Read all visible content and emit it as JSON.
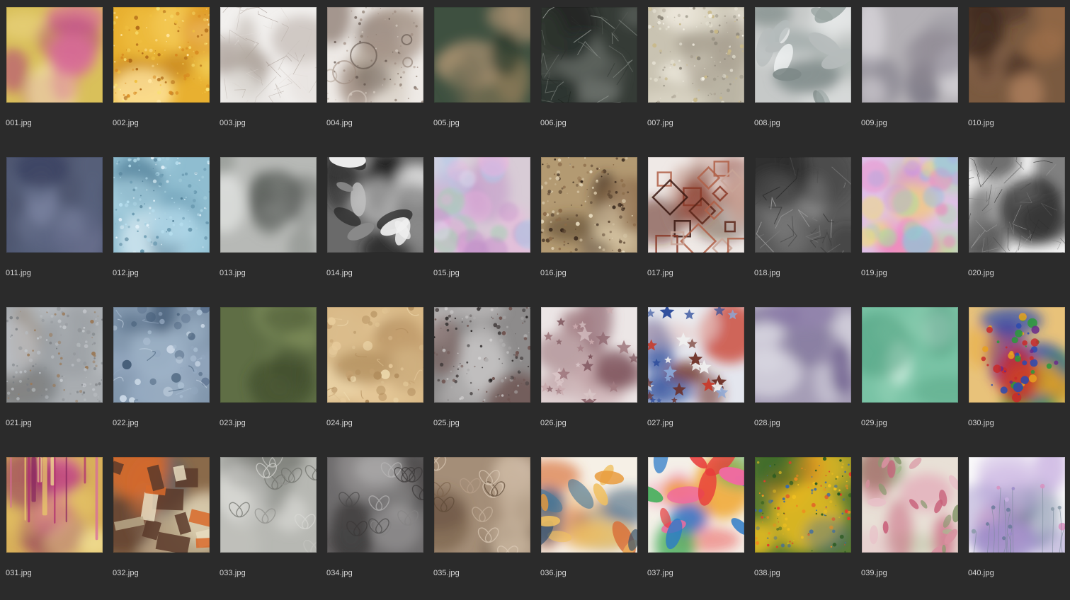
{
  "window": {
    "view": "thumbnail-grid"
  },
  "files": [
    {
      "name": "001.jpg",
      "thumb": {
        "bg": "#d9c05a",
        "colors": [
          "#e8d07a",
          "#c8a84a",
          "#b0407a",
          "#d86a9a",
          "#f0e0a0"
        ],
        "style": "blotch"
      }
    },
    {
      "name": "002.jpg",
      "thumb": {
        "bg": "#e8b030",
        "colors": [
          "#f0c040",
          "#d88a20",
          "#f8e070",
          "#b06a18",
          "#ffe6a0"
        ],
        "style": "speckle"
      }
    },
    {
      "name": "003.jpg",
      "thumb": {
        "bg": "#f2f0ee",
        "colors": [
          "#c9c2bc",
          "#b8aea6",
          "#dcd6d0",
          "#a99e96",
          "#e6e2de"
        ],
        "style": "lines"
      }
    },
    {
      "name": "004.jpg",
      "thumb": {
        "bg": "#eeeae6",
        "colors": [
          "#8a7a6e",
          "#b8aa9e",
          "#5e5048",
          "#d6ccc2",
          "#9e8c80"
        ],
        "style": "rings"
      }
    },
    {
      "name": "005.jpg",
      "thumb": {
        "bg": "#3e5040",
        "colors": [
          "#2a3a2c",
          "#6e6a50",
          "#8a7a58",
          "#4e5e48",
          "#a89070"
        ],
        "style": "blotch"
      }
    },
    {
      "name": "006.jpg",
      "thumb": {
        "bg": "#353b36",
        "colors": [
          "#1e2420",
          "#5a605a",
          "#7a807a",
          "#2c322e",
          "#9aa09a"
        ],
        "style": "cracks"
      }
    },
    {
      "name": "007.jpg",
      "thumb": {
        "bg": "#c9c3b2",
        "colors": [
          "#a8a090",
          "#e0dccc",
          "#c8b888",
          "#8e887a",
          "#f0ece0"
        ],
        "style": "speckle"
      }
    },
    {
      "name": "008.jpg",
      "thumb": {
        "bg": "#c6c9c8",
        "colors": [
          "#e6e8e8",
          "#9aa5a3",
          "#b6bcbc",
          "#7e8a88",
          "#f2f4f4"
        ],
        "style": "petals"
      }
    },
    {
      "name": "009.jpg",
      "thumb": {
        "bg": "#b3b0b5",
        "colors": [
          "#d8d6da",
          "#8e8a94",
          "#9e8aa8",
          "#e8e6ea",
          "#767280"
        ],
        "style": "blotch"
      }
    },
    {
      "name": "010.jpg",
      "thumb": {
        "bg": "#7a5a40",
        "colors": [
          "#a0704a",
          "#5a3e2a",
          "#c8906a",
          "#8a6850",
          "#3e2a1e"
        ],
        "style": "blotch"
      }
    },
    {
      "name": "011.jpg",
      "thumb": {
        "bg": "#4f5771",
        "colors": [
          "#3a4260",
          "#6a7290",
          "#5a6480",
          "#2e3450",
          "#7a82a0"
        ],
        "style": "blotch"
      }
    },
    {
      "name": "012.jpg",
      "thumb": {
        "bg": "#8fbdd0",
        "colors": [
          "#b8e0f0",
          "#6a9ab0",
          "#e0f0f8",
          "#4a7890",
          "#a8d0e0"
        ],
        "style": "speckle"
      }
    },
    {
      "name": "013.jpg",
      "thumb": {
        "bg": "#b7b9b6",
        "colors": [
          "#e0e2e0",
          "#7a7e7a",
          "#f0f2f0",
          "#5a5e5a",
          "#c8cac8"
        ],
        "style": "blotch"
      }
    },
    {
      "name": "014.jpg",
      "thumb": {
        "bg": "#6a6a6a",
        "colors": [
          "#1a1a1a",
          "#f0f0f0",
          "#3a3a3a",
          "#c0c0c0",
          "#8a8a8a"
        ],
        "style": "petals"
      }
    },
    {
      "name": "015.jpg",
      "thumb": {
        "bg": "#d8ccd6",
        "colors": [
          "#f0b0e0",
          "#a0d0b0",
          "#e0e0f0",
          "#c090c8",
          "#b0c8e8"
        ],
        "style": "bokeh"
      }
    },
    {
      "name": "016.jpg",
      "thumb": {
        "bg": "#b39a72",
        "colors": [
          "#3a2a1e",
          "#d8c8a8",
          "#8a6a48",
          "#5a4430",
          "#e8dcc0"
        ],
        "style": "speckle"
      }
    },
    {
      "name": "017.jpg",
      "thumb": {
        "bg": "#efe9e6",
        "colors": [
          "#5a2418",
          "#8a3a28",
          "#3a1810",
          "#b06048",
          "#c8a498"
        ],
        "style": "geo"
      }
    },
    {
      "name": "018.jpg",
      "thumb": {
        "bg": "#5a5a5a",
        "colors": [
          "#3a3a3a",
          "#7a7a7a",
          "#2a2a2a",
          "#9a9a9a",
          "#4a4a4a"
        ],
        "style": "cracks"
      }
    },
    {
      "name": "019.jpg",
      "thumb": {
        "bg": "#e0c0e8",
        "colors": [
          "#f080c0",
          "#80c0f0",
          "#f0e070",
          "#a0e0a0",
          "#c090f0"
        ],
        "style": "bokeh"
      }
    },
    {
      "name": "020.jpg",
      "thumb": {
        "bg": "#f4f4f4",
        "colors": [
          "#202020",
          "#505050",
          "#808080",
          "#303030",
          "#a0a0a0"
        ],
        "style": "lines"
      }
    },
    {
      "name": "021.jpg",
      "thumb": {
        "bg": "#a9adb1",
        "colors": [
          "#c0c4c8",
          "#8e9296",
          "#b6babe",
          "#7a7e82",
          "#9a7a5a"
        ],
        "style": "speckle"
      }
    },
    {
      "name": "022.jpg",
      "thumb": {
        "bg": "#8297ad",
        "colors": [
          "#a8bcd0",
          "#5e7490",
          "#c8d6e4",
          "#48607a",
          "#94a8c0"
        ],
        "style": "crumple"
      }
    },
    {
      "name": "023.jpg",
      "thumb": {
        "bg": "#5f6e45",
        "colors": [
          "#7a8a58",
          "#4a5836",
          "#8e9a66",
          "#3e4a2c",
          "#6a7a4c"
        ],
        "style": "blotch"
      }
    },
    {
      "name": "024.jpg",
      "thumb": {
        "bg": "#d9b987",
        "colors": [
          "#e8cc9c",
          "#c4a070",
          "#f0dcb0",
          "#b08c5c",
          "#dcc090"
        ],
        "style": "crumple"
      }
    },
    {
      "name": "025.jpg",
      "thumb": {
        "bg": "#8d8b8b",
        "colors": [
          "#d8d6d6",
          "#4a4444",
          "#6e5450",
          "#b0aeae",
          "#2e2a2a"
        ],
        "style": "speckle"
      }
    },
    {
      "name": "026.jpg",
      "thumb": {
        "bg": "#ece6e6",
        "colors": [
          "#a07a80",
          "#c8a8ac",
          "#7a5058",
          "#d8c4c6",
          "#906870"
        ],
        "style": "stars"
      }
    },
    {
      "name": "027.jpg",
      "thumb": {
        "bg": "#e4e6ee",
        "colors": [
          "#c83a2a",
          "#2a4a9a",
          "#6a2a20",
          "#8aa8d8",
          "#f0f0f0"
        ],
        "style": "stars"
      }
    },
    {
      "name": "028.jpg",
      "thumb": {
        "bg": "#a59db6",
        "colors": [
          "#6a5a8a",
          "#d8d6e0",
          "#8a7aa8",
          "#c0b8d0",
          "#4a3e6a"
        ],
        "style": "blotch"
      }
    },
    {
      "name": "029.jpg",
      "thumb": {
        "bg": "#79c3a5",
        "colors": [
          "#a8dcc4",
          "#5aa888",
          "#d0eee0",
          "#489878",
          "#90d0b4"
        ],
        "style": "blotch"
      }
    },
    {
      "name": "030.jpg",
      "thumb": {
        "bg": "#e8c27a",
        "colors": [
          "#c82a2a",
          "#2a4ab0",
          "#2a9a3a",
          "#e8a020",
          "#6a2a8a"
        ],
        "style": "splash"
      }
    },
    {
      "name": "031.jpg",
      "thumb": {
        "bg": "#d8b05a",
        "colors": [
          "#b03070",
          "#e8c86a",
          "#8a2a60",
          "#d86aa0",
          "#f0dc90"
        ],
        "style": "drips"
      }
    },
    {
      "name": "032.jpg",
      "thumb": {
        "bg": "#8a6a4a",
        "colors": [
          "#d86a2a",
          "#3a5a7a",
          "#e8dcc0",
          "#5a3a2a",
          "#b8a888"
        ],
        "style": "collage"
      }
    },
    {
      "name": "033.jpg",
      "thumb": {
        "bg": "#b7b8b3",
        "colors": [
          "#d8d8d4",
          "#8e8f8a",
          "#e6e6e2",
          "#6e6f6a",
          "#c4c5c0"
        ],
        "style": "damask"
      }
    },
    {
      "name": "034.jpg",
      "thumb": {
        "bg": "#6e6c6d",
        "colors": [
          "#9a9898",
          "#4a4848",
          "#b8b6b6",
          "#3a3838",
          "#858383"
        ],
        "style": "damask"
      }
    },
    {
      "name": "035.jpg",
      "thumb": {
        "bg": "#a48e78",
        "colors": [
          "#c8b49e",
          "#7a624c",
          "#dccab6",
          "#5e4a38",
          "#b8a08a"
        ],
        "style": "damask"
      }
    },
    {
      "name": "036.jpg",
      "thumb": {
        "bg": "#f6f0e6",
        "colors": [
          "#e89a3a",
          "#2e4e6e",
          "#f0c060",
          "#4a7a9a",
          "#d8703a"
        ],
        "style": "leaves"
      }
    },
    {
      "name": "037.jpg",
      "thumb": {
        "bg": "#f4f0e8",
        "colors": [
          "#e83a3a",
          "#f0a020",
          "#2a7ac8",
          "#4ab060",
          "#f06aa0"
        ],
        "style": "leaves"
      }
    },
    {
      "name": "038.jpg",
      "thumb": {
        "bg": "#5a7a30",
        "colors": [
          "#e83a2a",
          "#f0c020",
          "#3a6aa8",
          "#2a5a20",
          "#f08a20"
        ],
        "style": "speckle"
      }
    },
    {
      "name": "039.jpg",
      "thumb": {
        "bg": "#e8e0d6",
        "colors": [
          "#d890a0",
          "#a8b890",
          "#c8607a",
          "#e8c0c8",
          "#8a9a70"
        ],
        "style": "flowers"
      }
    },
    {
      "name": "040.jpg",
      "thumb": {
        "bg": "#fafafa",
        "colors": [
          "#9a8ac8",
          "#d890c0",
          "#6a7a9a",
          "#c8b0e0",
          "#8a9aa8"
        ],
        "style": "wild"
      }
    }
  ]
}
